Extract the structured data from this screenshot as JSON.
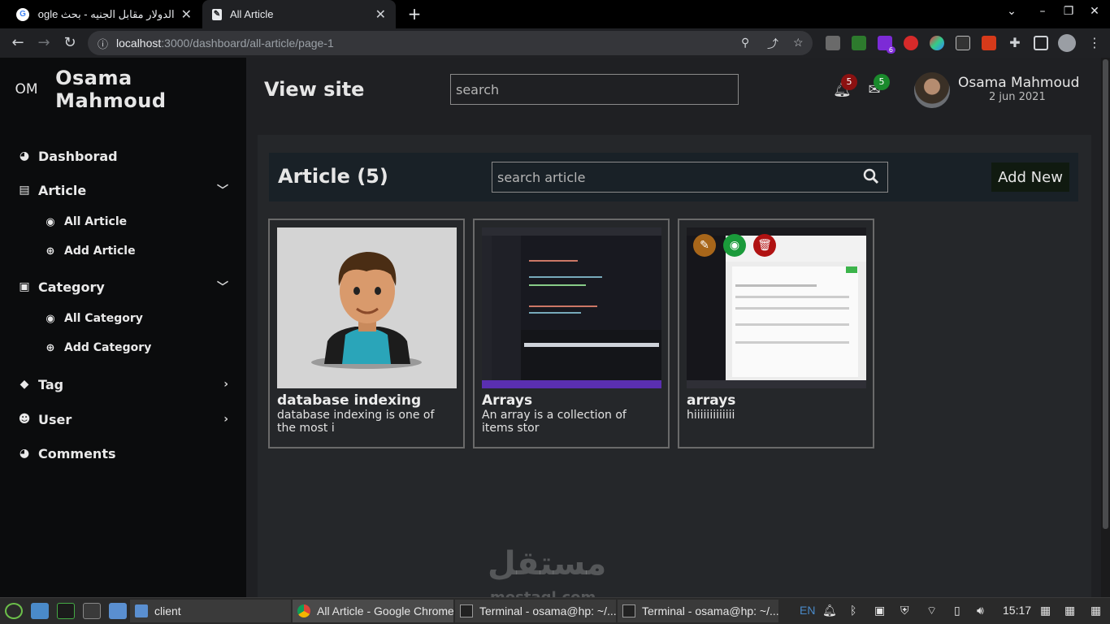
{
  "browser": {
    "tabs": [
      {
        "title": "الدولار مقابل الجنيه - بحث Google",
        "state": "inactive"
      },
      {
        "title": "All Article",
        "state": "active"
      }
    ],
    "url_host": "localhost",
    "url_path": ":3000/dashboard/all-article/page-1"
  },
  "sidebar": {
    "logo": "OM",
    "brand": "Osama Mahmoud",
    "items": [
      {
        "label": "Dashborad",
        "icon": "dashboard-icon"
      },
      {
        "label": "Article",
        "icon": "article-icon"
      },
      {
        "label": "All Article",
        "icon": "eye-icon"
      },
      {
        "label": "Add Article",
        "icon": "plus-circle-icon"
      },
      {
        "label": "Category",
        "icon": "category-icon"
      },
      {
        "label": "All Category",
        "icon": "eye-icon"
      },
      {
        "label": "Add Category",
        "icon": "plus-circle-icon"
      },
      {
        "label": "Tag",
        "icon": "tag-icon"
      },
      {
        "label": "User",
        "icon": "users-icon"
      },
      {
        "label": "Comments",
        "icon": "comments-icon"
      }
    ]
  },
  "topbar": {
    "view_site": "View site",
    "search_placeholder": "search",
    "notifications_count": "5",
    "messages_count": "5",
    "user_name": "Osama Mahmoud",
    "user_date": "2 jun 2021"
  },
  "main": {
    "title": "Article (5)",
    "search_placeholder": "search article",
    "add_new": "Add New",
    "articles": [
      {
        "title": "database indexing",
        "desc": "database indexing is one of the most i"
      },
      {
        "title": "Arrays",
        "desc": "An array is a collection of items stor"
      },
      {
        "title": "arrays",
        "desc": "hiiiiiiiiiiiii"
      }
    ]
  },
  "watermark": {
    "arabic": "مستقل",
    "latin": "mostaql.com"
  },
  "taskbar": {
    "tasks": [
      "client",
      "All Article - Google Chrome",
      "Terminal - osama@hp: ~/...",
      "Terminal - osama@hp: ~/..."
    ],
    "lang": "EN",
    "time": "15:17"
  },
  "colors": {
    "notif_badge": "#8b1111",
    "msg_badge": "#1a8a2c",
    "edit": "#a8661a",
    "view": "#1a9a3a",
    "delete": "#b01212"
  }
}
